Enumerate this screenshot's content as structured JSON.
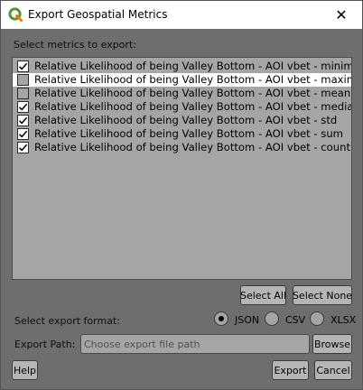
{
  "window": {
    "title": "Export Geospatial Metrics",
    "app_icon": "qgis-icon",
    "close_icon": "close-icon"
  },
  "metrics_section": {
    "label": "Select metrics to export:",
    "items": [
      {
        "label": "Relative Likelihood of being Valley Bottom - AOI vbet - minimum",
        "checked": true,
        "selected": false
      },
      {
        "label": "Relative Likelihood of being Valley Bottom - AOI vbet - maximum",
        "checked": false,
        "selected": true
      },
      {
        "label": "Relative Likelihood of being Valley Bottom - AOI vbet - mean",
        "checked": false,
        "selected": false
      },
      {
        "label": "Relative Likelihood of being Valley Bottom - AOI vbet - median",
        "checked": true,
        "selected": false
      },
      {
        "label": "Relative Likelihood of being Valley Bottom - AOI vbet - std",
        "checked": true,
        "selected": false
      },
      {
        "label": "Relative Likelihood of being Valley Bottom - AOI vbet - sum",
        "checked": true,
        "selected": false
      },
      {
        "label": "Relative Likelihood of being Valley Bottom - AOI vbet - count",
        "checked": true,
        "selected": false
      }
    ],
    "select_all_label": "Select All",
    "select_none_label": "Select None"
  },
  "format_section": {
    "label": "Select export format:",
    "options": [
      {
        "label": "JSON",
        "checked": true
      },
      {
        "label": "CSV",
        "checked": false
      },
      {
        "label": "XLSX",
        "checked": false
      }
    ]
  },
  "path_section": {
    "label": "Export Path:",
    "placeholder": "Choose export file path",
    "value": "",
    "browse_label": "Browse"
  },
  "footer": {
    "help_label": "Help",
    "export_label": "Export",
    "cancel_label": "Cancel"
  },
  "colors": {
    "dialog_bg": "#6e6e6e",
    "list_bg": "#a5a5a5",
    "button_bg": "#b5b5b5",
    "selected_row": "#ffffff",
    "qgis_green": "#589632",
    "qgis_yellow": "#ee7913"
  }
}
